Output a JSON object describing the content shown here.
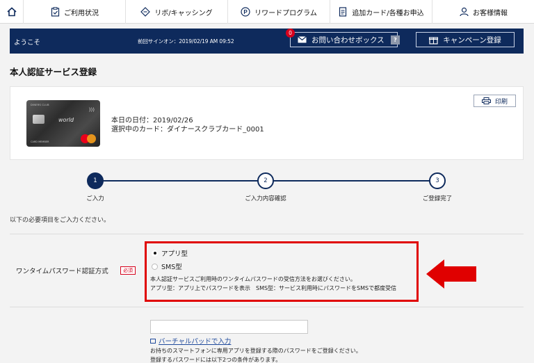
{
  "nav": {
    "home_icon": "home-icon",
    "items": [
      {
        "label": "ご利用状況",
        "icon": "clipboard-icon"
      },
      {
        "label": "リボ/キャッシング",
        "icon": "diamond-arrows-icon"
      },
      {
        "label": "リワードプログラム",
        "icon": "p-circle-icon"
      },
      {
        "label": "追加カード/各種お申込",
        "icon": "document-icon"
      },
      {
        "label": "お客様情報",
        "icon": "person-icon"
      }
    ]
  },
  "welcome": {
    "greeting": "ようこそ",
    "last_signin": "前回サインオン：2019/02/19 AM 09:52",
    "inquiry_label": "お問い合わせボックス",
    "inquiry_badge": "0",
    "help_label": "?",
    "campaign_label": "キャンペーン登録"
  },
  "page": {
    "title": "本人認証サービス登録"
  },
  "card_info": {
    "date_line": "本日の日付：2019/02/26",
    "card_line": "選択中のカード：ダイナースクラブカード_0001",
    "print_label": "印刷",
    "card_brand": "world",
    "card_top_text": "DINERS CLUB",
    "card_member_text": "CARD MEMBER"
  },
  "steps": [
    {
      "number": "1",
      "label": "ご入力",
      "active": true
    },
    {
      "number": "2",
      "label": "ご入力内容確認",
      "active": false
    },
    {
      "number": "3",
      "label": "ご登録完了",
      "active": false
    }
  ],
  "form": {
    "intro": "以下の必要項目をご入力ください。",
    "otp_label": "ワンタイムパスワード認証方式",
    "required_badge": "必須",
    "option_app": "アプリ型",
    "option_sms": "SMS型",
    "selected": "アプリ型",
    "desc_line1": "本人認証サービスご利用時のワンタイムパスワードの受信方法をお選びください。",
    "desc_line2": "アプリ型：アプリ上でパスワードを表示　SMS型：サービス利用時にパスワードをSMSで都度受信",
    "password_value": "",
    "vpad_link": "バーチャルパッドで入力",
    "note_line1": "お持ちのスマートフォンに専用アプリを登録する際のパスワードをご登録ください。",
    "note_line2": "登録するパスワードには以下2つの条件があります。"
  },
  "colors": {
    "navy": "#0e2a5c",
    "highlight_red": "#e00000",
    "required_red": "#d6001c"
  }
}
